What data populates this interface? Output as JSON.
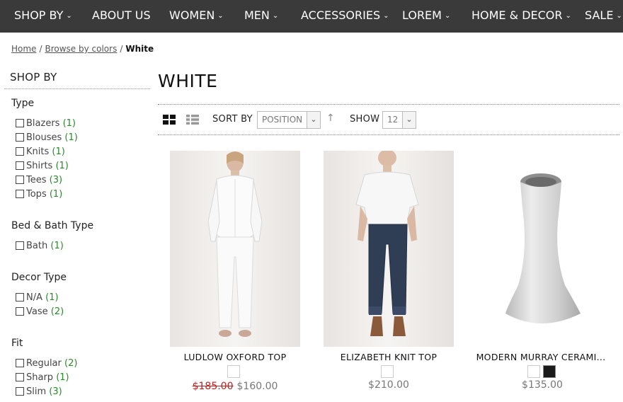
{
  "nav": {
    "items": [
      {
        "label": "SHOP BY",
        "has_chevron": true
      },
      {
        "label": "ABOUT US",
        "has_chevron": false
      },
      {
        "label": "WOMEN",
        "has_chevron": true
      },
      {
        "label": "MEN",
        "has_chevron": true
      },
      {
        "label": "ACCESSORIES",
        "has_chevron": true
      },
      {
        "label": "LOREM",
        "has_chevron": true
      },
      {
        "label": "HOME & DECOR",
        "has_chevron": true
      },
      {
        "label": "SALE",
        "has_chevron": true
      }
    ]
  },
  "breadcrumb": {
    "links": [
      "Home",
      "Browse by colors"
    ],
    "current": "White",
    "separator": "/"
  },
  "sidebar": {
    "title": "SHOP BY",
    "groups": [
      {
        "title": "Type",
        "options": [
          {
            "label": "Blazers",
            "count": "(1)"
          },
          {
            "label": "Blouses",
            "count": "(1)"
          },
          {
            "label": "Knits",
            "count": "(1)"
          },
          {
            "label": "Shirts",
            "count": "(1)"
          },
          {
            "label": "Tees",
            "count": "(3)"
          },
          {
            "label": "Tops",
            "count": "(1)"
          }
        ]
      },
      {
        "title": "Bed & Bath Type",
        "options": [
          {
            "label": "Bath",
            "count": "(1)"
          }
        ]
      },
      {
        "title": "Decor Type",
        "options": [
          {
            "label": "N/A",
            "count": "(1)"
          },
          {
            "label": "Vase",
            "count": "(2)"
          }
        ]
      },
      {
        "title": "Fit",
        "options": [
          {
            "label": "Regular",
            "count": "(2)"
          },
          {
            "label": "Sharp",
            "count": "(1)"
          },
          {
            "label": "Slim",
            "count": "(3)"
          }
        ]
      }
    ]
  },
  "main": {
    "title": "WHITE",
    "toolbar": {
      "sort_label": "SORT BY",
      "sort_value": "POSITION",
      "sort_dir_icon": "up-arrow-icon",
      "show_label": "SHOW",
      "show_value": "12",
      "view_modes": [
        "grid-view-icon",
        "list-view-icon"
      ],
      "active_view": "grid"
    },
    "products": [
      {
        "name": "LUDLOW OXFORD TOP",
        "old_price": "$185.00",
        "price": "$160.00",
        "swatches": [
          "#ffffff"
        ]
      },
      {
        "name": "ELIZABETH KNIT TOP",
        "old_price": "",
        "price": "$210.00",
        "swatches": [
          "#ffffff"
        ]
      },
      {
        "name": "MODERN MURRAY CERAMI...",
        "old_price": "",
        "price": "$135.00",
        "swatches": [
          "#ffffff",
          "#1a1a1a"
        ]
      }
    ]
  },
  "colors": {
    "nav_bg": "#3a3a3a",
    "count_green": "#2a8a2a",
    "old_price_red": "#b22222"
  }
}
